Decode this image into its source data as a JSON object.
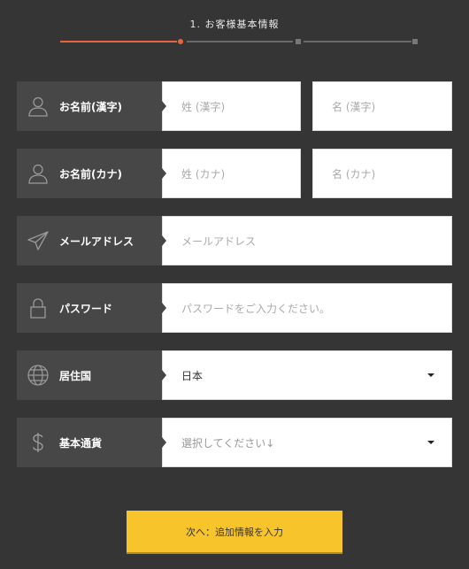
{
  "header": {
    "step_title": "1. お客様基本情報",
    "progress_step": 1,
    "progress_total": 3,
    "accent_color": "#e8643c"
  },
  "form": {
    "rows": [
      {
        "label": "お名前(漢字)",
        "icon": "user-icon",
        "fields": [
          {
            "placeholder": "姓 (漢字)"
          },
          {
            "placeholder": "名 (漢字)"
          }
        ]
      },
      {
        "label": "お名前(カナ)",
        "icon": "user-icon",
        "fields": [
          {
            "placeholder": "姓 (カナ)"
          },
          {
            "placeholder": "名 (カナ)"
          }
        ]
      },
      {
        "label": "メールアドレス",
        "icon": "paper-plane-icon",
        "fields": [
          {
            "placeholder": "メールアドレス"
          }
        ]
      },
      {
        "label": "パスワード",
        "icon": "lock-icon",
        "fields": [
          {
            "placeholder": "パスワードをご入力ください。"
          }
        ]
      },
      {
        "label": "居住国",
        "icon": "globe-icon",
        "fields": [
          {
            "value": "日本"
          }
        ]
      },
      {
        "label": "基本通貨",
        "icon": "dollar-icon",
        "fields": [
          {
            "value": "選択してください↓"
          }
        ]
      }
    ]
  },
  "submit": {
    "label": "次へ：追加情報を入力",
    "color": "#f7c52b"
  }
}
